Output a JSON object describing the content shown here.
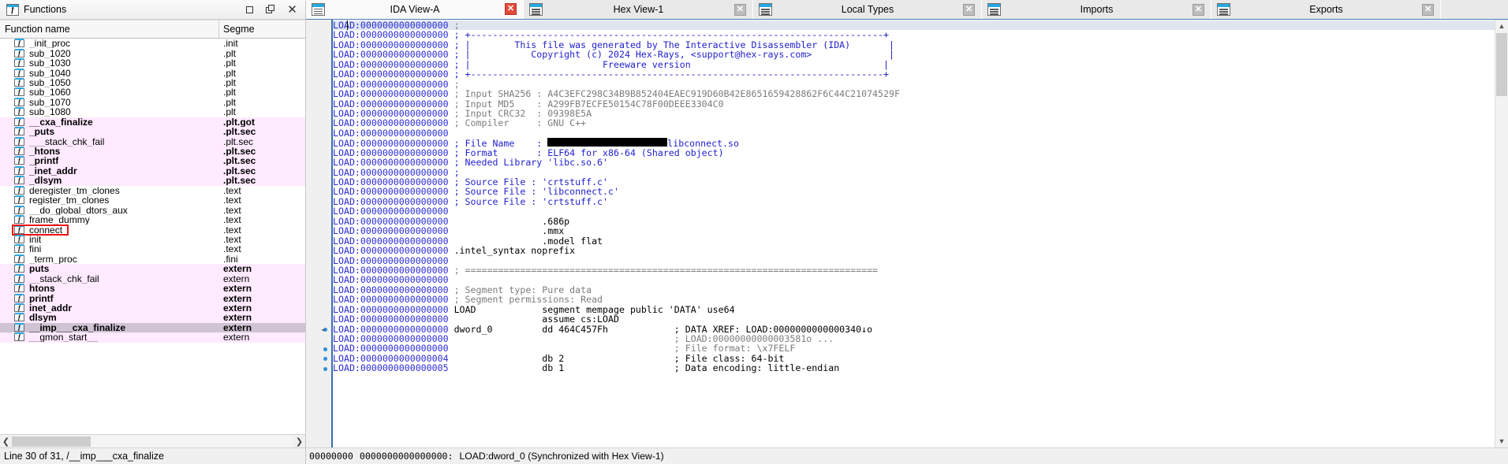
{
  "functions_panel": {
    "title": "Functions",
    "icon": "function-icon",
    "window_buttons": [
      {
        "name": "restore-button",
        "glyph": "▭"
      },
      {
        "name": "maximize-button",
        "glyph": "❐"
      },
      {
        "name": "close-button",
        "glyph": "×"
      }
    ],
    "columns": [
      "Function name",
      "Segme"
    ],
    "status": "Line 30 of 31, /__imp___cxa_finalize",
    "rows": [
      {
        "name": "_init_proc",
        "segment": ".init",
        "style": "normal"
      },
      {
        "name": "sub_1020",
        "segment": ".plt",
        "style": "normal"
      },
      {
        "name": "sub_1030",
        "segment": ".plt",
        "style": "normal"
      },
      {
        "name": "sub_1040",
        "segment": ".plt",
        "style": "normal"
      },
      {
        "name": "sub_1050",
        "segment": ".plt",
        "style": "normal"
      },
      {
        "name": "sub_1060",
        "segment": ".plt",
        "style": "normal"
      },
      {
        "name": "sub_1070",
        "segment": ".plt",
        "style": "normal"
      },
      {
        "name": "sub_1080",
        "segment": ".plt",
        "style": "normal"
      },
      {
        "name": "__cxa_finalize",
        "segment": ".plt.got",
        "style": "lib"
      },
      {
        "name": "_puts",
        "segment": ".plt.sec",
        "style": "lib"
      },
      {
        "name": "___stack_chk_fail",
        "segment": ".plt.sec",
        "style": "lib-thin"
      },
      {
        "name": "_htons",
        "segment": ".plt.sec",
        "style": "lib"
      },
      {
        "name": "_printf",
        "segment": ".plt.sec",
        "style": "lib"
      },
      {
        "name": "_inet_addr",
        "segment": ".plt.sec",
        "style": "lib"
      },
      {
        "name": "_dlsym",
        "segment": ".plt.sec",
        "style": "lib"
      },
      {
        "name": "deregister_tm_clones",
        "segment": ".text",
        "style": "normal"
      },
      {
        "name": "register_tm_clones",
        "segment": ".text",
        "style": "normal"
      },
      {
        "name": "__do_global_dtors_aux",
        "segment": ".text",
        "style": "normal"
      },
      {
        "name": "frame_dummy",
        "segment": ".text",
        "style": "normal"
      },
      {
        "name": "connect",
        "segment": ".text",
        "style": "normal",
        "highlighted": true
      },
      {
        "name": "init",
        "segment": ".text",
        "style": "normal"
      },
      {
        "name": "fini",
        "segment": ".text",
        "style": "normal"
      },
      {
        "name": "_term_proc",
        "segment": ".fini",
        "style": "normal"
      },
      {
        "name": "puts",
        "segment": "extern",
        "style": "lib"
      },
      {
        "name": "__stack_chk_fail",
        "segment": "extern",
        "style": "lib-thin"
      },
      {
        "name": "htons",
        "segment": "extern",
        "style": "lib"
      },
      {
        "name": "printf",
        "segment": "extern",
        "style": "lib"
      },
      {
        "name": "inet_addr",
        "segment": "extern",
        "style": "lib"
      },
      {
        "name": "dlsym",
        "segment": "extern",
        "style": "lib"
      },
      {
        "name": "__imp___cxa_finalize",
        "segment": "extern",
        "style": "selected"
      },
      {
        "name": "__gmon_start__",
        "segment": "extern",
        "style": "lib-thin"
      }
    ]
  },
  "tabs": [
    {
      "label": "IDA View-A",
      "icon": "ida-view-icon",
      "active": true,
      "close_icon": "close-icon",
      "close_style": "red"
    },
    {
      "label": "Hex View-1",
      "icon": "hex-view-icon",
      "active": false,
      "close_icon": "close-icon",
      "close_style": "gray"
    },
    {
      "label": "Local Types",
      "icon": "local-types-icon",
      "active": false,
      "close_icon": "close-icon",
      "close_style": "gray"
    },
    {
      "label": "Imports",
      "icon": "imports-icon",
      "active": false,
      "close_icon": "close-icon",
      "close_style": "gray"
    },
    {
      "label": "Exports",
      "icon": "exports-icon",
      "active": false,
      "close_icon": "close-icon",
      "close_style": "gray"
    }
  ],
  "disassembly": {
    "address_prefix": "LOAD:0000000000000000",
    "lines": [
      {
        "addr": "LOAD:0000000000000000",
        "text": ";",
        "color": "gray",
        "cursor": true
      },
      {
        "addr": "LOAD:0000000000000000",
        "text": "; +---------------------------------------------------------------------------+",
        "color": "blue"
      },
      {
        "addr": "LOAD:0000000000000000",
        "text": "; |        This file was generated by The Interactive Disassembler (IDA)       |",
        "color": "blue"
      },
      {
        "addr": "LOAD:0000000000000000",
        "text": "; |           Copyright (c) 2024 Hex-Rays, <support@hex-rays.com>              |",
        "color": "blue"
      },
      {
        "addr": "LOAD:0000000000000000",
        "text": "; |                        Freeware version                                   |",
        "color": "blue"
      },
      {
        "addr": "LOAD:0000000000000000",
        "text": "; +---------------------------------------------------------------------------+",
        "color": "blue"
      },
      {
        "addr": "LOAD:0000000000000000",
        "text": ";",
        "color": "gray"
      },
      {
        "addr": "LOAD:0000000000000000",
        "text": "; Input SHA256 : A4C3EFC298C34B9B852404EAEC919D60B42E8651659428862F6C44C21074529F",
        "color": "gray"
      },
      {
        "addr": "LOAD:0000000000000000",
        "text": "; Input MD5    : A299FB7ECFE50154C78F00DEEE3304C0",
        "color": "gray"
      },
      {
        "addr": "LOAD:0000000000000000",
        "text": "; Input CRC32  : 09398E5A",
        "color": "gray"
      },
      {
        "addr": "LOAD:0000000000000000",
        "text": "; Compiler     : GNU C++",
        "color": "gray"
      },
      {
        "addr": "LOAD:0000000000000000",
        "text": "",
        "color": "gray"
      },
      {
        "addr": "LOAD:0000000000000000",
        "text": "; File Name    :",
        "color": "blue",
        "redacted": true,
        "redacted_width": 152,
        "after_redact": "libconnect.so"
      },
      {
        "addr": "LOAD:0000000000000000",
        "text": "; Format       : ELF64 for x86-64 (Shared object)",
        "color": "blue"
      },
      {
        "addr": "LOAD:0000000000000000",
        "text": "; Needed Library 'libc.so.6'",
        "color": "blue"
      },
      {
        "addr": "LOAD:0000000000000000",
        "text": ";",
        "color": "blue"
      },
      {
        "addr": "LOAD:0000000000000000",
        "text": "; Source File : 'crtstuff.c'",
        "color": "blue"
      },
      {
        "addr": "LOAD:0000000000000000",
        "text": "; Source File : 'libconnect.c'",
        "color": "blue"
      },
      {
        "addr": "LOAD:0000000000000000",
        "text": "; Source File : 'crtstuff.c'",
        "color": "blue"
      },
      {
        "addr": "LOAD:0000000000000000",
        "text": "",
        "color": "blue"
      },
      {
        "addr": "LOAD:0000000000000000",
        "text": "                .686p",
        "color": "black"
      },
      {
        "addr": "LOAD:0000000000000000",
        "text": "                .mmx",
        "color": "black"
      },
      {
        "addr": "LOAD:0000000000000000",
        "text": "                .model flat",
        "color": "black"
      },
      {
        "addr": "LOAD:0000000000000000",
        "text": ".intel_syntax noprefix",
        "color": "black"
      },
      {
        "addr": "LOAD:0000000000000000",
        "text": "",
        "color": "black"
      },
      {
        "addr": "LOAD:0000000000000000",
        "text": "; ===========================================================================",
        "color": "gray"
      },
      {
        "addr": "LOAD:0000000000000000",
        "text": "",
        "color": "gray"
      },
      {
        "addr": "LOAD:0000000000000000",
        "text": "; Segment type: Pure data",
        "color": "gray"
      },
      {
        "addr": "LOAD:0000000000000000",
        "text": "; Segment permissions: Read",
        "color": "gray"
      },
      {
        "addr": "LOAD:0000000000000000",
        "text": "LOAD            segment mempage public 'DATA' use64",
        "color": "black"
      },
      {
        "addr": "LOAD:0000000000000000",
        "text": "                assume cs:LOAD",
        "color": "black"
      },
      {
        "addr": "LOAD:0000000000000000",
        "text": "dword_0         dd 464C457Fh            ; DATA XREF: LOAD:0000000000000340↓o",
        "color": "black",
        "expander": true,
        "dot": true
      },
      {
        "addr": "LOAD:0000000000000000",
        "text": "                                        ; LOAD:00000000000003581o ...",
        "color": "gray"
      },
      {
        "addr": "LOAD:0000000000000000",
        "text": "                                        ; File format: \\x7FELF",
        "color": "gray",
        "dot": true
      },
      {
        "addr": "LOAD:0000000000000004",
        "text": "                db 2                    ; File class: 64-bit",
        "color": "black",
        "dot": true
      },
      {
        "addr": "LOAD:0000000000000005",
        "text": "                db 1                    ; Data encoding: little-endian",
        "color": "black",
        "dot": true
      }
    ],
    "status_bar": {
      "offset": "00000000",
      "address": "0000000000000000:",
      "label": "LOAD:dword_0 (Synchronized with Hex View-1)"
    }
  },
  "colors": {
    "library_row": "#ffeaff",
    "selected_row": "#cfc3d4",
    "highlight_box": "#ee1111",
    "address_text": "#2b2bd4",
    "comment_gray": "#7c7c7c",
    "tab_active": "#fafafa",
    "icon_blue": "#29abe2"
  }
}
